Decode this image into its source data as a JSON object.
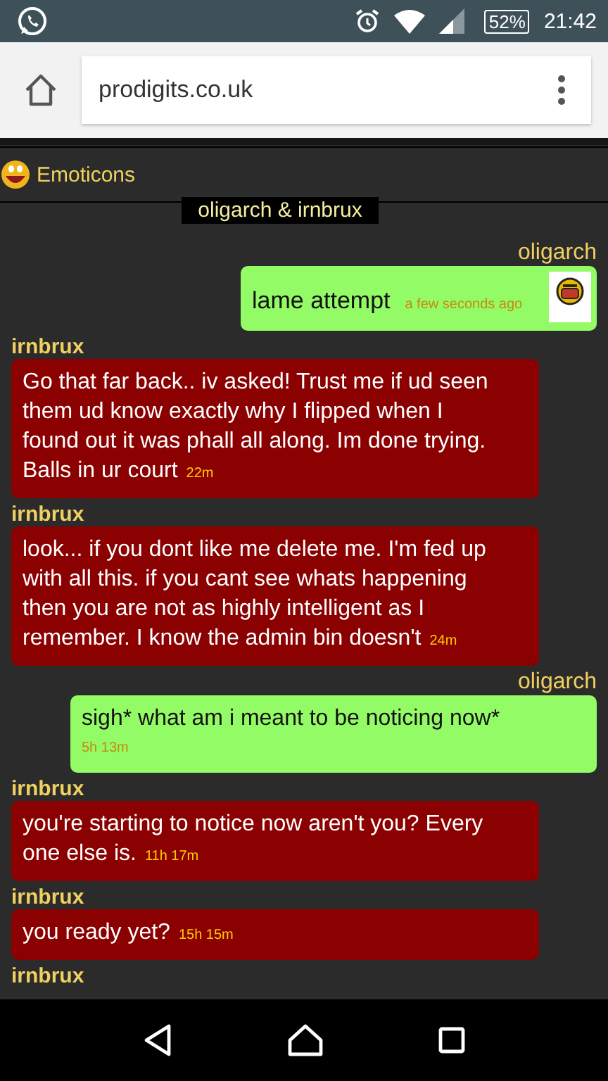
{
  "status_bar": {
    "battery": "52%",
    "time": "21:42"
  },
  "browser": {
    "url": "prodigits.co.uk"
  },
  "emoticons_link": "Emoticons",
  "conversation_title": "oligarch & irnbrux",
  "messages": [
    {
      "kind": "sent",
      "sender": "oligarch",
      "text": "lame attempt",
      "time": "a few seconds ago",
      "emoticon": true
    },
    {
      "kind": "received",
      "sender": "irnbrux",
      "text": "Go that far back.. iv asked! Trust me if ud seen them ud know exactly why I flipped when I found out it was phall all along. Im done trying. Balls in ur court",
      "time": "22m"
    },
    {
      "kind": "received",
      "sender": "irnbrux",
      "text": "look... if you dont like me delete me. I'm fed up with all this. if you cant see whats happening then you are not as highly intelligent as I remember. I know the admin bin doesn't",
      "time": "24m"
    },
    {
      "kind": "sent",
      "sender": "oligarch",
      "text": "sigh* what am i meant to be noticing now*",
      "time": "5h 13m",
      "emoticon": false
    },
    {
      "kind": "received",
      "sender": "irnbrux",
      "text": "you're starting to notice now aren't you? Every one else is.",
      "time": "11h 17m"
    },
    {
      "kind": "received",
      "sender": "irnbrux",
      "text": "you ready yet?",
      "time": "15h 15m"
    },
    {
      "kind": "received",
      "sender": "irnbrux"
    }
  ]
}
